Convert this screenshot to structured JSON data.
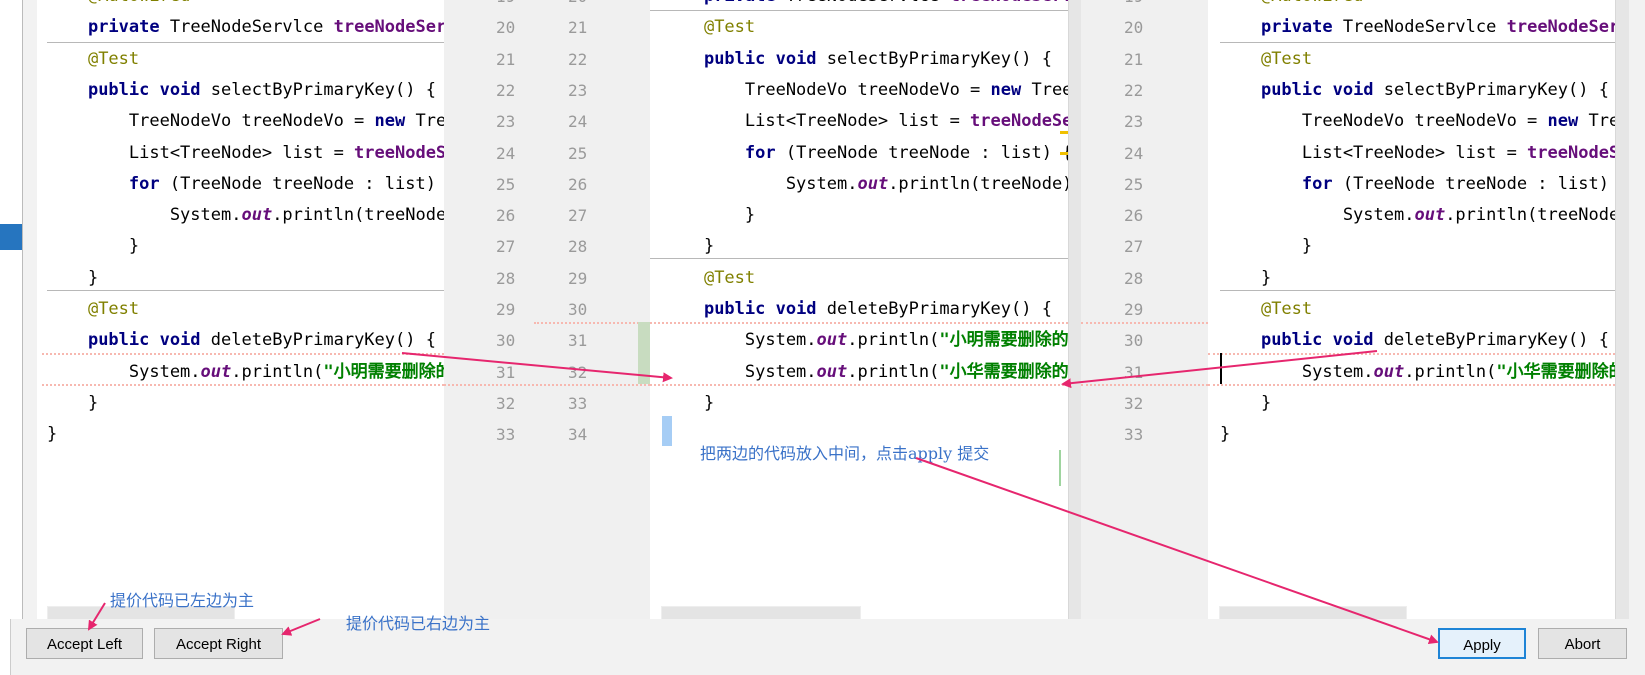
{
  "colors": {
    "keyword": "#000080",
    "annotation": "#808000",
    "field": "#660e7a",
    "string": "#008000",
    "arrow": "#e6266e",
    "note": "#3a72c8",
    "accent": "#1e84d6"
  },
  "left_panel": {
    "line_numbers": [
      "19",
      "20",
      "21",
      "22",
      "23",
      "24",
      "25",
      "26",
      "27",
      "28",
      "29",
      "30",
      "31",
      "32",
      "33"
    ],
    "lines": [
      [
        {
          "t": "    "
        },
        {
          "t": "@Autowired",
          "c": "an"
        }
      ],
      [
        {
          "t": "    "
        },
        {
          "t": "private",
          "c": "kw"
        },
        {
          "t": " TreeNodeServlce "
        },
        {
          "t": "treeNodeService",
          "c": "fd"
        }
      ],
      [
        {
          "t": "    "
        },
        {
          "t": "@Test",
          "c": "an"
        }
      ],
      [
        {
          "t": "    "
        },
        {
          "t": "public void",
          "c": "kw"
        },
        {
          "t": " selectByPrimaryKey() {"
        }
      ],
      [
        {
          "t": "        TreeNodeVo treeNodeVo = "
        },
        {
          "t": "new",
          "c": "kw"
        },
        {
          "t": " TreeNodeVo"
        }
      ],
      [
        {
          "t": "        List<TreeNode> list = "
        },
        {
          "t": "treeNodeService",
          "c": "fd"
        }
      ],
      [
        {
          "t": "        "
        },
        {
          "t": "for",
          "c": "kw"
        },
        {
          "t": " (TreeNode treeNode : list) {"
        }
      ],
      [
        {
          "t": "            System."
        },
        {
          "t": "out",
          "c": "it"
        },
        {
          "t": ".println(treeNode);"
        }
      ],
      [
        {
          "t": "        }"
        }
      ],
      [
        {
          "t": "    }"
        }
      ],
      [
        {
          "t": "    "
        },
        {
          "t": "@Test",
          "c": "an"
        }
      ],
      [
        {
          "t": "    "
        },
        {
          "t": "public void",
          "c": "kw"
        },
        {
          "t": " deleteByPrimaryKey() {"
        }
      ],
      [
        {
          "t": "        System."
        },
        {
          "t": "out",
          "c": "it"
        },
        {
          "t": ".println("
        },
        {
          "t": "\"小明需要删除的",
          "c": "st"
        }
      ],
      [
        {
          "t": "    }"
        }
      ],
      [
        {
          "t": "}"
        }
      ]
    ]
  },
  "middle_panel": {
    "line_numbers": [
      "20",
      "21",
      "22",
      "23",
      "24",
      "25",
      "26",
      "27",
      "28",
      "29",
      "30",
      "31",
      "32",
      "33",
      "34"
    ],
    "lines": [
      [
        {
          "t": "    "
        },
        {
          "t": "private",
          "c": "kw"
        },
        {
          "t": " TreeNodeServlce "
        },
        {
          "t": "treeNodeService",
          "c": "fd"
        }
      ],
      [
        {
          "t": "    "
        },
        {
          "t": "@Test",
          "c": "an"
        }
      ],
      [
        {
          "t": "    "
        },
        {
          "t": "public void",
          "c": "kw"
        },
        {
          "t": " selectByPrimaryKey() {"
        }
      ],
      [
        {
          "t": "        TreeNodeVo treeNodeVo = "
        },
        {
          "t": "new",
          "c": "kw"
        },
        {
          "t": " TreeNodeVo"
        }
      ],
      [
        {
          "t": "        List<TreeNode> list = "
        },
        {
          "t": "treeNodeService",
          "c": "fd"
        }
      ],
      [
        {
          "t": "        "
        },
        {
          "t": "for",
          "c": "kw"
        },
        {
          "t": " (TreeNode treeNode : list) {"
        }
      ],
      [
        {
          "t": "            System."
        },
        {
          "t": "out",
          "c": "it"
        },
        {
          "t": ".println(treeNode);"
        }
      ],
      [
        {
          "t": "        }"
        }
      ],
      [
        {
          "t": "    }"
        }
      ],
      [
        {
          "t": "    "
        },
        {
          "t": "@Test",
          "c": "an"
        }
      ],
      [
        {
          "t": "    "
        },
        {
          "t": "public void",
          "c": "kw"
        },
        {
          "t": " deleteByPrimaryKey() {"
        }
      ],
      [
        {
          "t": "        System."
        },
        {
          "t": "out",
          "c": "it"
        },
        {
          "t": ".println("
        },
        {
          "t": "\"小明需要删除的",
          "c": "st"
        }
      ],
      [
        {
          "t": "        System."
        },
        {
          "t": "out",
          "c": "it"
        },
        {
          "t": ".println("
        },
        {
          "t": "\"小华需要删除的",
          "c": "st"
        }
      ],
      [
        {
          "t": "    }"
        }
      ],
      [
        {
          "t": "}"
        }
      ]
    ]
  },
  "right_panel": {
    "line_numbers": [
      "19",
      "20",
      "21",
      "22",
      "23",
      "24",
      "25",
      "26",
      "27",
      "28",
      "29",
      "30",
      "31",
      "32",
      "33"
    ],
    "lines": [
      [
        {
          "t": "    "
        },
        {
          "t": "@Autowired",
          "c": "an"
        }
      ],
      [
        {
          "t": "    "
        },
        {
          "t": "private",
          "c": "kw"
        },
        {
          "t": " TreeNodeServlce "
        },
        {
          "t": "treeNodeService",
          "c": "fd"
        }
      ],
      [
        {
          "t": "    "
        },
        {
          "t": "@Test",
          "c": "an"
        }
      ],
      [
        {
          "t": "    "
        },
        {
          "t": "public void",
          "c": "kw"
        },
        {
          "t": " selectByPrimaryKey() {"
        }
      ],
      [
        {
          "t": "        TreeNodeVo treeNodeVo = "
        },
        {
          "t": "new",
          "c": "kw"
        },
        {
          "t": " TreeNodeVo"
        }
      ],
      [
        {
          "t": "        List<TreeNode> list = "
        },
        {
          "t": "treeNodeService",
          "c": "fd"
        }
      ],
      [
        {
          "t": "        "
        },
        {
          "t": "for",
          "c": "kw"
        },
        {
          "t": " (TreeNode treeNode : list) {"
        }
      ],
      [
        {
          "t": "            System."
        },
        {
          "t": "out",
          "c": "it"
        },
        {
          "t": ".println(treeNode);"
        }
      ],
      [
        {
          "t": "        }"
        }
      ],
      [
        {
          "t": "    }"
        }
      ],
      [
        {
          "t": "    "
        },
        {
          "t": "@Test",
          "c": "an"
        }
      ],
      [
        {
          "t": "    "
        },
        {
          "t": "public void",
          "c": "kw"
        },
        {
          "t": " deleteByPrimaryKey() {"
        }
      ],
      [
        {
          "t": "        System."
        },
        {
          "t": "out",
          "c": "it"
        },
        {
          "t": ".println("
        },
        {
          "t": "\"小华需要删除的",
          "c": "st"
        }
      ],
      [
        {
          "t": "    }"
        }
      ],
      [
        {
          "t": "}"
        }
      ]
    ]
  },
  "buttons": {
    "accept_left": "Accept Left",
    "accept_right": "Accept Right",
    "apply": "Apply",
    "abort": "Abort"
  },
  "annotations": {
    "left_note": "提价代码已左边为主",
    "right_note": "提价代码已右边为主",
    "middle_note": "把两边的代码放入中间，点击apply 提交"
  }
}
